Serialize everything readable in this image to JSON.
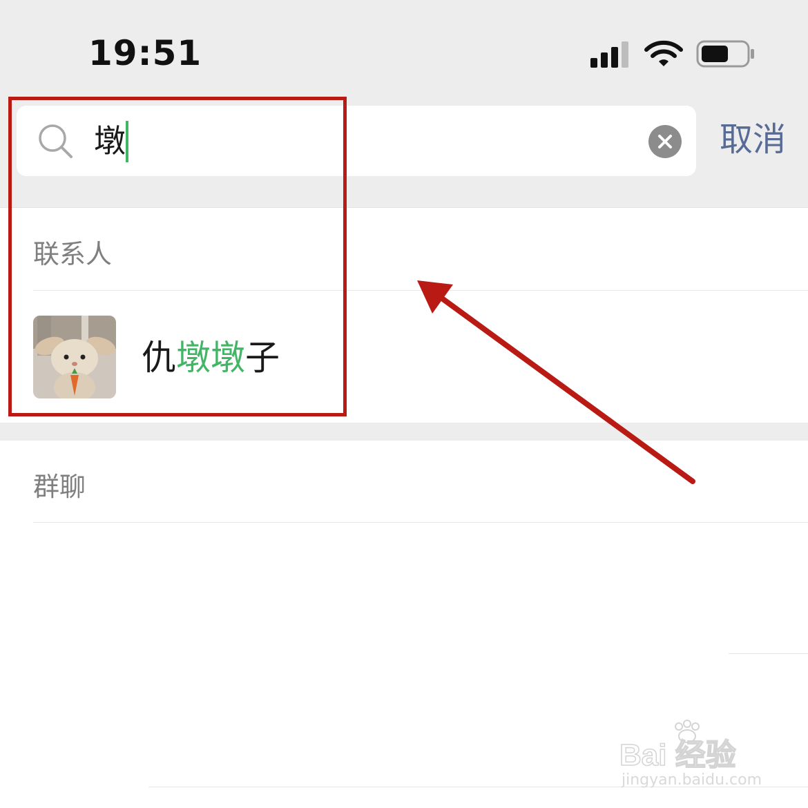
{
  "status_bar": {
    "time": "19:51",
    "icons": [
      "signal-icon",
      "wifi-icon",
      "battery-icon"
    ]
  },
  "search": {
    "value": "墩",
    "cancel_label": "取消",
    "icons": [
      "search-icon",
      "clear-icon"
    ]
  },
  "sections": {
    "contacts": {
      "title": "联系人",
      "results": [
        {
          "name_parts": [
            "仇",
            "墩墩",
            "子"
          ],
          "avatar": "bunny-plush-avatar"
        }
      ]
    },
    "groups": {
      "title": "群聊"
    }
  },
  "watermark": {
    "logo_text": "Bai 经验",
    "url": "jingyan.baidu.com"
  },
  "colors": {
    "highlight_green": "#43b567",
    "cancel_blue": "#576b95",
    "annotation_red": "#b91a14",
    "header_grey": "#ededed"
  }
}
